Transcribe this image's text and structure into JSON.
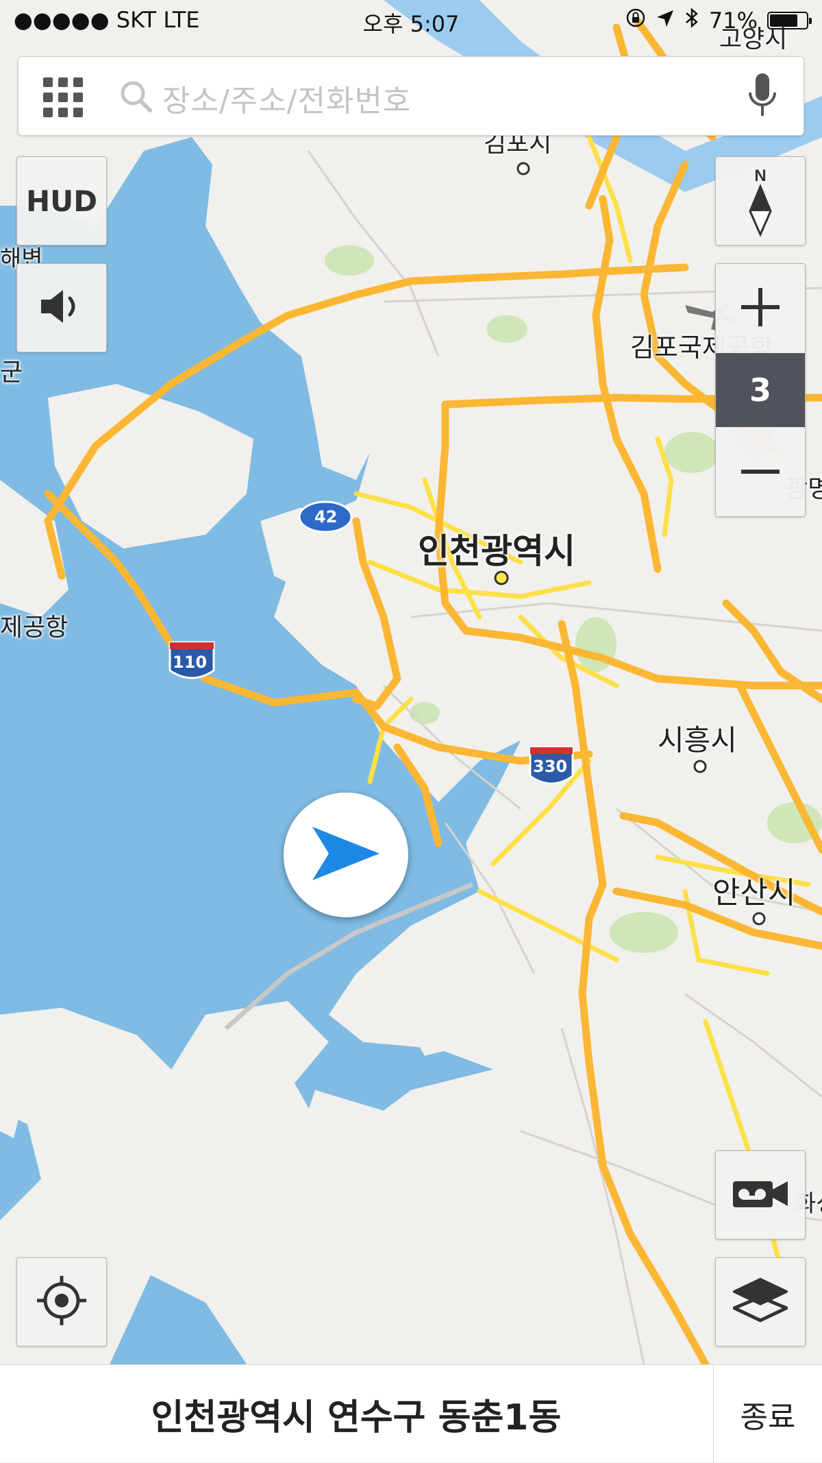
{
  "status_bar": {
    "carrier": "●●●●● SKT   LTE",
    "time": "오후 5:07",
    "battery": "71%"
  },
  "search": {
    "placeholder": "장소/주소/전화번호"
  },
  "buttons": {
    "hud": "HUD",
    "zoom_level": "3",
    "compass_north": "N"
  },
  "map_labels": {
    "incheon": "인천광역시",
    "gimpo_airport": "김포국제공항",
    "siheung": "시흥시",
    "ansan": "안산시",
    "gimpo_top": "김포시",
    "goyang": "고양시",
    "left_coast": "해변",
    "left_gun": "군",
    "left_airport": "제공항",
    "right_gwang": "광명",
    "right_bottom": "화성"
  },
  "road_shields": {
    "r42": "42",
    "r110": "110",
    "r330": "330"
  },
  "bottom_bar": {
    "address": "인천광역시 연수구 동춘1동",
    "end_button": "종료"
  },
  "colors": {
    "sea": "#7fbbe3",
    "land": "#f1f0ed",
    "major_road": "#fbb734",
    "minor_road": "#fde046",
    "location_arrow": "#1e88e5"
  }
}
